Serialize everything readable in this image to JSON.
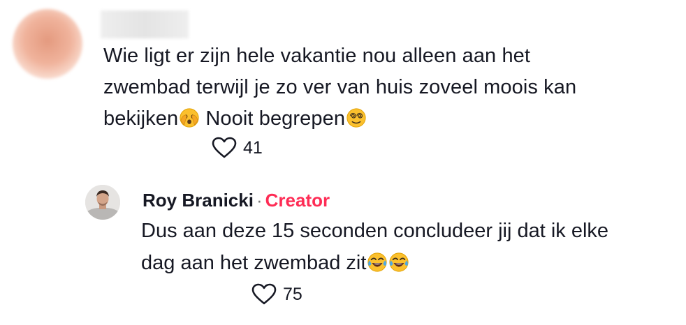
{
  "comment": {
    "line1": "Wie ligt er zijn hele vakantie nou alleen aan het",
    "line2": "zwembad terwijl je zo ver van huis zoveel moois kan",
    "line3a": "bekijken",
    "line3b": " Nooit begrepen",
    "likes": "41"
  },
  "reply": {
    "author": "Roy Branicki",
    "separator": "·",
    "badge": "Creator",
    "line1": "Dus aan deze 15 seconden concludeer jij dat ik elke",
    "line2": "dag aan het zwembad zit",
    "likes": "75"
  },
  "colors": {
    "text": "#161823",
    "creator_badge": "#fe2c55",
    "icon": "#161823"
  },
  "icons": {
    "like": "heart-outline-icon",
    "emoji_1": "face-peeking-eye-icon",
    "emoji_2": "face-with-spiral-eyes-icon",
    "emoji_3": "face-with-tears-of-joy-icon"
  }
}
